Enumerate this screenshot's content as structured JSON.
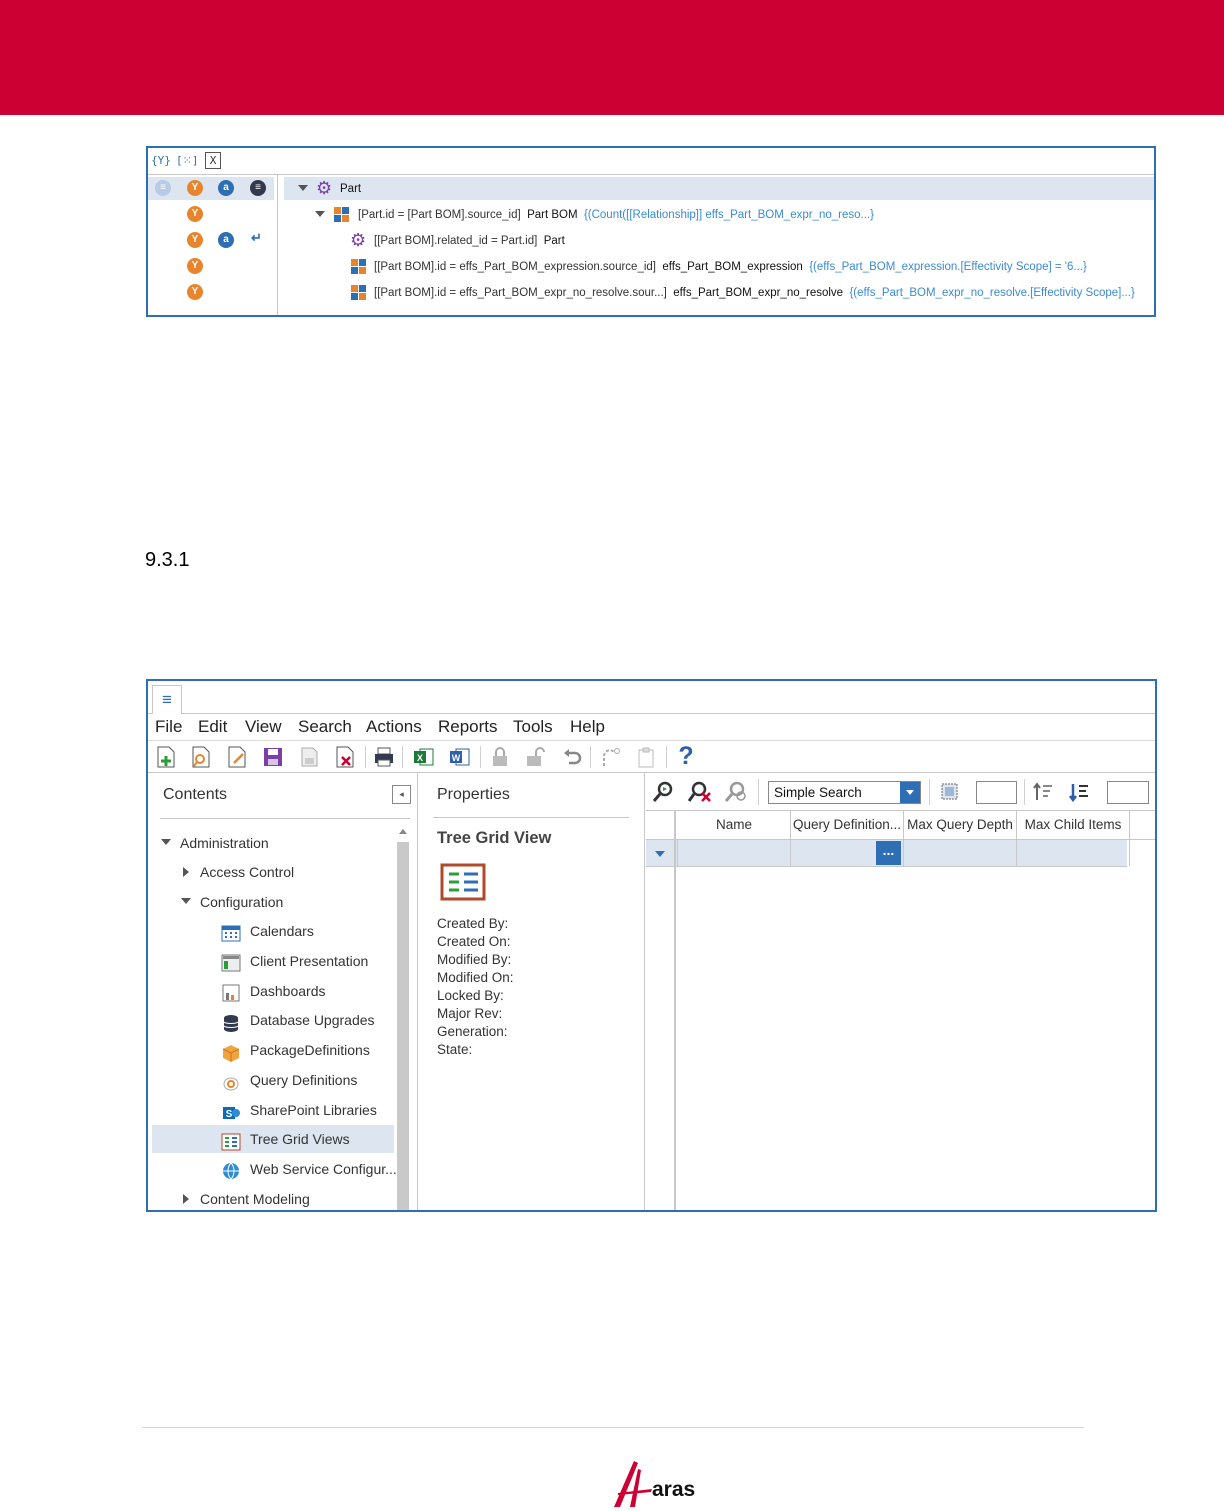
{
  "query_tree": {
    "toolbar_icons": [
      "{Y}",
      "[⁙]",
      "X"
    ],
    "rows": [
      {
        "prefix": "",
        "name": "Part",
        "condition": ""
      },
      {
        "prefix": "[Part.id = [Part BOM].source_id]",
        "name": "Part BOM",
        "condition": "{(Count([[Relationship]] effs_Part_BOM_expr_no_reso...}"
      },
      {
        "prefix": "[[Part BOM].related_id = Part.id]",
        "name": "Part",
        "condition": ""
      },
      {
        "prefix": "[[Part BOM].id = effs_Part_BOM_expression.source_id]",
        "name": "effs_Part_BOM_expression",
        "condition": "{(effs_Part_BOM_expression.[Effectivity Scope] = '6...}"
      },
      {
        "prefix": "[[Part BOM].id = effs_Part_BOM_expr_no_resolve.sour...]",
        "name": "effs_Part_BOM_expr_no_resolve",
        "condition": "{(effs_Part_BOM_expr_no_resolve.[Effectivity Scope]...}"
      }
    ]
  },
  "section_heading": "9.3.1",
  "app": {
    "menu": [
      "File",
      "Edit",
      "View",
      "Search",
      "Actions",
      "Reports",
      "Tools",
      "Help"
    ],
    "toolbar_icons": [
      "new-icon",
      "search-icon",
      "edit-icon",
      "save-icon",
      "save-disabled-icon",
      "delete-icon",
      "print-icon",
      "excel-icon",
      "word-icon",
      "lock-icon",
      "unlock-icon",
      "undo-icon",
      "promote-icon",
      "clipboard-icon",
      "help-icon"
    ],
    "help_glyph": "?",
    "contents": {
      "title": "Contents",
      "items": [
        {
          "label": "Administration"
        },
        {
          "label": "Access Control"
        },
        {
          "label": "Configuration"
        },
        {
          "label": "Calendars"
        },
        {
          "label": "Client Presentation"
        },
        {
          "label": "Dashboards"
        },
        {
          "label": "Database Upgrades"
        },
        {
          "label": "PackageDefinitions"
        },
        {
          "label": "Query Definitions"
        },
        {
          "label": "SharePoint Libraries"
        },
        {
          "label": "Tree Grid Views"
        },
        {
          "label": "Web Service Configur..."
        },
        {
          "label": "Content Modeling"
        }
      ]
    },
    "properties": {
      "title": "Properties",
      "item_type": "Tree Grid View",
      "fields": [
        "Created By:",
        "Created On:",
        "Modified By:",
        "Modified On:",
        "Locked By:",
        "Major Rev:",
        "Generation:",
        "State:"
      ]
    },
    "grid": {
      "search_mode": "Simple Search",
      "columns": [
        "Name",
        "Query Definition...",
        "Max Query Depth",
        "Max Child Items"
      ],
      "ellipsis": "..."
    }
  },
  "footer": {
    "logo_text": "aras"
  },
  "colors": {
    "brand_red": "#cc0033",
    "accent_blue": "#2e6eb5",
    "orange": "#e8842c",
    "selection": "#dde5f0"
  }
}
